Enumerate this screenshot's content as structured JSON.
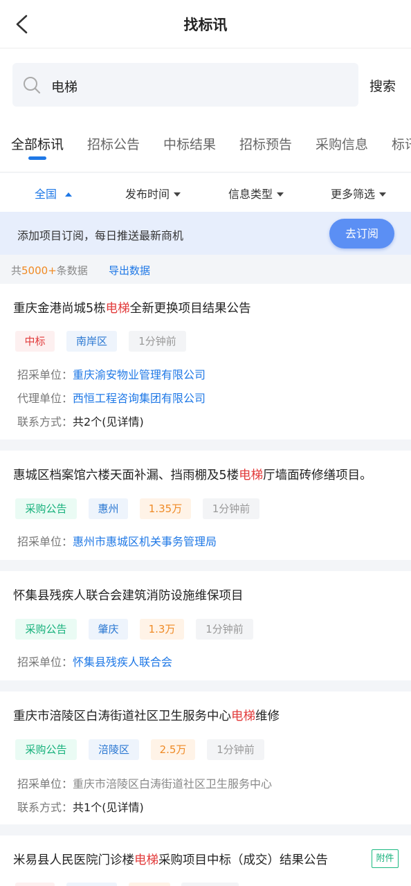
{
  "header": {
    "title": "找标讯"
  },
  "search": {
    "value": "电梯",
    "button_label": "搜索"
  },
  "tabs": [
    "全部标讯",
    "招标公告",
    "中标结果",
    "招标预告",
    "采购信息",
    "标讯"
  ],
  "filters": [
    "全国",
    "发布时间",
    "信息类型",
    "更多筛选"
  ],
  "subscribe": {
    "text": "添加项目订阅，每日推送最新商机",
    "button_label": "去订阅"
  },
  "summary": {
    "prefix": "共",
    "count": "5000+",
    "suffix": "条数据",
    "export_label": "导出数据"
  },
  "cards": [
    {
      "title_pre": "重庆金港尚城5栋",
      "title_hl": "电梯",
      "title_post": "全新更换项目结果公告",
      "tags": [
        "中标",
        "南岸区",
        "1分钟前"
      ],
      "rows": [
        {
          "label": "招采单位：",
          "value": "重庆渝安物业管理有限公司"
        },
        {
          "label": "代理单位：",
          "value": "西恒工程咨询集团有限公司"
        },
        {
          "label": "联系方式：",
          "value": "共2个(见详情)"
        }
      ]
    },
    {
      "title_pre": "惠城区档案馆六楼天面补漏、挡雨棚及5楼",
      "title_hl": "电梯",
      "title_post": "厅墙面砖修缮项目。",
      "tags": [
        "采购公告",
        "惠州",
        "1.35万",
        "1分钟前"
      ],
      "rows": [
        {
          "label": "招采单位：",
          "value": "惠州市惠城区机关事务管理局"
        }
      ]
    },
    {
      "title_pre": "怀集县残疾人联合会建筑消防设施维保项目",
      "title_hl": "",
      "title_post": "",
      "tags": [
        "采购公告",
        "肇庆",
        "1.3万",
        "1分钟前"
      ],
      "rows": [
        {
          "label": "招采单位：",
          "value": "怀集县残疾人联合会"
        }
      ]
    },
    {
      "title_pre": "重庆市涪陵区白涛街道社区卫生服务中心",
      "title_hl": "电梯",
      "title_post": "维修",
      "tags": [
        "采购公告",
        "涪陵区",
        "2.5万",
        "1分钟前"
      ],
      "rows": [
        {
          "label": "招采单位：",
          "value": "重庆市涪陵区白涛街道社区卫生服务中心"
        },
        {
          "label": "联系方式：",
          "value": "共1个(见详情)"
        }
      ]
    },
    {
      "title_pre": "米易县人民医院门诊楼",
      "title_hl": "电梯",
      "title_post": "采购项目中标（成交）结果公告",
      "badge": "附件",
      "tags": [],
      "rows": []
    }
  ],
  "colors": {
    "accent": "#1f78e6",
    "highlight": "#e23b3b",
    "orange": "#f08a23",
    "green": "#14b07a"
  }
}
